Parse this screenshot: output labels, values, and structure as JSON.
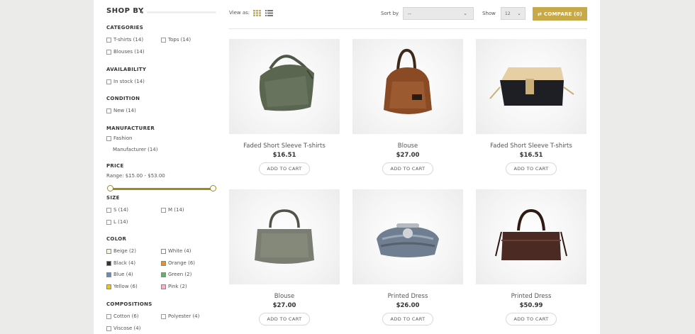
{
  "sidebar": {
    "title": "SHOP BY",
    "sections": {
      "categories": {
        "title": "CATEGORIES",
        "items": [
          "T-shirts (14)",
          "Tops (14)",
          "Blouses (14)"
        ]
      },
      "availability": {
        "title": "AVAILABILITY",
        "items": [
          "In stock (14)"
        ]
      },
      "condition": {
        "title": "CONDITION",
        "items": [
          "New (14)"
        ]
      },
      "manufacturer": {
        "title": "MANUFACTURER",
        "items": [
          "Fashion",
          "Manufacturer (14)"
        ]
      },
      "price": {
        "title": "PRICE",
        "range": "Range: $15.00 - $53.00"
      },
      "size": {
        "title": "SIZE",
        "items": [
          "S (14)",
          "M (14)",
          "L (14)"
        ]
      },
      "color": {
        "title": "COLOR",
        "items": [
          {
            "label": "Beige (2)",
            "color": "#f5f5dc"
          },
          {
            "label": "White (4)",
            "color": "#ffffff"
          },
          {
            "label": "Black (4)",
            "color": "#333333"
          },
          {
            "label": "Orange (6)",
            "color": "#e6941f"
          },
          {
            "label": "Blue (4)",
            "color": "#5a8fd6"
          },
          {
            "label": "Green (2)",
            "color": "#5cb85c"
          },
          {
            "label": "Yellow (6)",
            "color": "#f1c40f"
          },
          {
            "label": "Pink (2)",
            "color": "#f5b3c8"
          }
        ]
      },
      "compositions": {
        "title": "COMPOSITIONS",
        "items": [
          "Cotton (6)",
          "Polyester (4)",
          "Viscose (4)"
        ]
      }
    }
  },
  "toolbar": {
    "view_as": "View as:",
    "sort_by": "Sort by",
    "sort_value": "--",
    "show": "Show",
    "show_value": "12",
    "compare_label": "COMPARE (0)"
  },
  "products": [
    {
      "name": "Faded Short Sleeve T-shirts",
      "price": "$16.51",
      "button": "ADD TO CART",
      "icon": "olive-hobo-bag"
    },
    {
      "name": "Blouse",
      "price": "$27.00",
      "button": "ADD TO CART",
      "icon": "brown-leather-bag"
    },
    {
      "name": "Faded Short Sleeve T-shirts",
      "price": "$16.51",
      "button": "ADD TO CART",
      "icon": "beige-black-satchel"
    },
    {
      "name": "Blouse",
      "price": "$27.00",
      "button": "ADD TO CART",
      "icon": "grey-tote-bag"
    },
    {
      "name": "Printed Dress",
      "price": "$26.00",
      "button": "ADD TO CART",
      "icon": "feather-clutch"
    },
    {
      "name": "Printed Dress",
      "price": "$50.99",
      "button": "ADD TO CART",
      "icon": "dark-brown-duffel"
    }
  ],
  "colors": {
    "accent": "#c8a94a",
    "slider": "#a08a20",
    "background": "#ebebe9"
  }
}
